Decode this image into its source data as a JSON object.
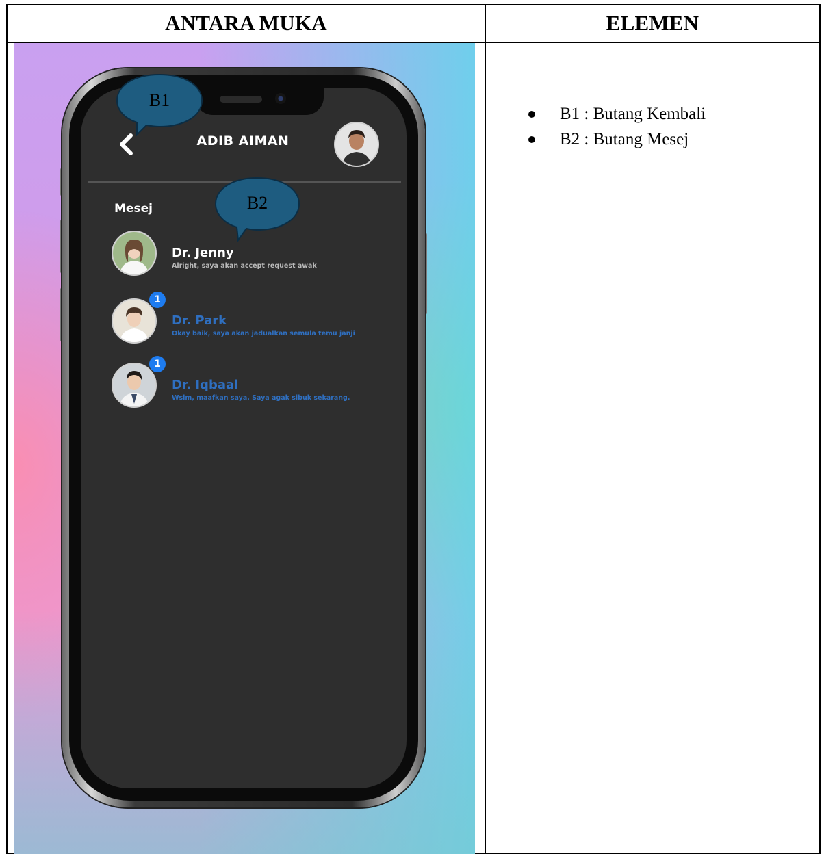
{
  "table": {
    "headers": [
      "ANTARA MUKA",
      "ELEMEN"
    ]
  },
  "app": {
    "user_name": "ADIB AIMAN",
    "section_title": "Mesej",
    "contacts": [
      {
        "name": "Dr. Jenny",
        "message": "Alright, saya akan accept request awak",
        "unread_count": "",
        "state": "read"
      },
      {
        "name": "Dr. Park",
        "message": "Okay baik, saya akan jadualkan semula temu janji",
        "unread_count": "1",
        "state": "unread"
      },
      {
        "name": "Dr. Iqbaal",
        "message": "Wslm, maafkan saya. Saya agak sibuk sekarang.",
        "unread_count": "1",
        "state": "unread"
      }
    ],
    "colors": {
      "screen_bg": "#2e2e2e",
      "unread_text": "#2f6fc0",
      "badge": "#1e7cf0",
      "callout_fill": "#1e5c80"
    }
  },
  "callouts": [
    {
      "label": "B1"
    },
    {
      "label": "B2"
    }
  ],
  "elements": [
    {
      "text": "B1 : Butang Kembali"
    },
    {
      "text": "B2 : Butang Mesej"
    }
  ]
}
